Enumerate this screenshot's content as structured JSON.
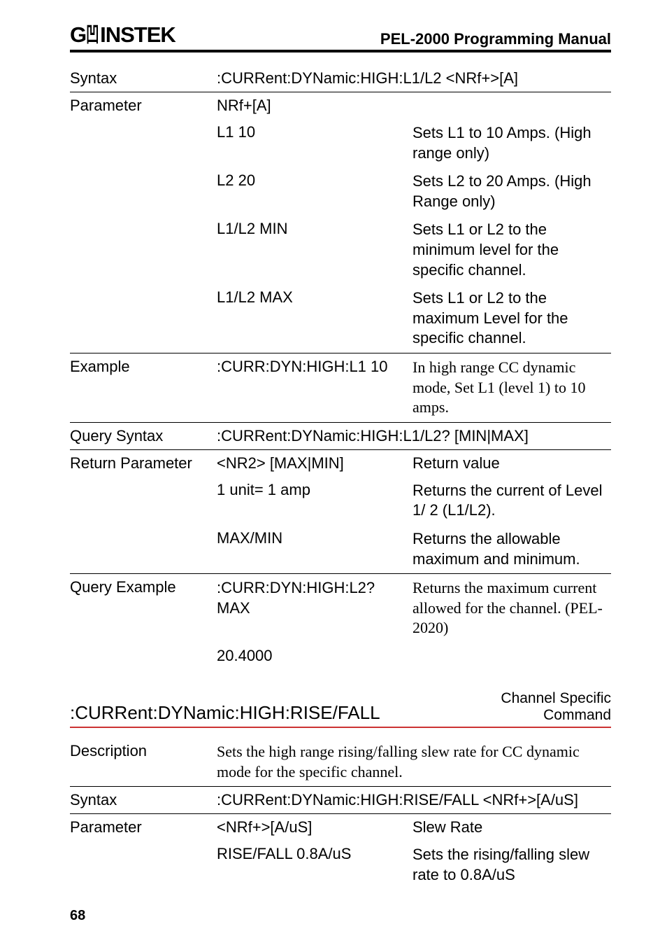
{
  "header": {
    "logo_pre": "G",
    "logo_post": "INSTEK",
    "manual": "PEL-2000 Programming Manual"
  },
  "tbl1": {
    "rows": [
      {
        "cls": "",
        "c1": "Syntax",
        "c2": ":CURRent:DYNamic:HIGH:L1/L2 <NRf+>[A]",
        "c3": "",
        "span": true,
        "c2cls": "sans"
      },
      {
        "cls": "sep",
        "c1": "Parameter",
        "c2": "NRf+[A]",
        "c3": "",
        "c2cls": "sans"
      },
      {
        "cls": "",
        "c1": "",
        "c2": "L1 10",
        "c3": "Sets L1 to 10 Amps. (High range only)",
        "c2cls": "sans",
        "c3cls": "sans lh"
      },
      {
        "cls": "",
        "c1": "",
        "c2": "L2 20",
        "c3": "Sets L2 to 20 Amps. (High Range only)",
        "c2cls": "sans",
        "c3cls": "sans lh"
      },
      {
        "cls": "",
        "c1": "",
        "c2": "L1/L2 MIN",
        "c3": "Sets L1 or L2 to the minimum level for the specific channel.",
        "c2cls": "sans",
        "c3cls": "sans lh"
      },
      {
        "cls": "",
        "c1": "",
        "c2": "L1/L2 MAX",
        "c3": "Sets L1 or L2 to the maximum Level for the specific channel.",
        "c2cls": "sans",
        "c3cls": "sans lh"
      },
      {
        "cls": "sep",
        "c1": "Example",
        "c2": ":CURR:DYN:HIGH:L1 10",
        "c3": "In high range CC dynamic mode, Set L1 (level 1) to 10 amps.",
        "c2cls": "sans",
        "c3cls": "serif lh"
      },
      {
        "cls": "sep",
        "c1": "Query Syntax",
        "c2": ":CURRent:DYNamic:HIGH:L1/L2? [MIN|MAX]",
        "c3": "",
        "span": true,
        "c2cls": "sans"
      },
      {
        "cls": "sep",
        "c1": "Return Parameter",
        "c2": "<NR2> [MAX|MIN]",
        "c3": "Return value",
        "c2cls": "sans",
        "c3cls": "sans"
      },
      {
        "cls": "",
        "c1": "",
        "c2": "1 unit= 1 amp",
        "c3": "Returns the current of Level 1/ 2 (L1/L2).",
        "c2cls": "sans",
        "c3cls": "sans lh"
      },
      {
        "cls": "",
        "c1": "",
        "c2": "MAX/MIN",
        "c3": "Returns the allowable maximum and minimum.",
        "c2cls": "sans",
        "c3cls": "sans lh"
      },
      {
        "cls": "sep",
        "c1": "Query Example",
        "c2": ":CURR:DYN:HIGH:L2? MAX",
        "c3": "Returns the maximum current allowed for the channel. (PEL-2020)",
        "c2cls": "sans lh",
        "c3cls": "serif lh"
      },
      {
        "cls": "",
        "c1": "",
        "c2": "20.4000",
        "c3": "",
        "c2cls": "sans"
      }
    ]
  },
  "section": {
    "cmd": ":CURRent:DYNamic:HIGH:RISE/FALL",
    "tag_l1": "Channel Specific",
    "tag_l2": "Command"
  },
  "tbl2": {
    "rows": [
      {
        "cls": "",
        "c1": "Description",
        "c2": "Sets the high range rising/falling slew rate for CC dynamic mode for the specific channel.",
        "c3": "",
        "span": true,
        "c2cls": "serif lh"
      },
      {
        "cls": "sep",
        "c1": "Syntax",
        "c2": ":CURRent:DYNamic:HIGH:RISE/FALL <NRf+>[A/uS]",
        "c3": "",
        "span": true,
        "c2cls": "sans"
      },
      {
        "cls": "sep",
        "c1": "Parameter",
        "c2": "<NRf+>[A/uS]",
        "c3": "Slew Rate",
        "c2cls": "sans",
        "c3cls": "sans"
      },
      {
        "cls": "",
        "c1": "",
        "c2": "RISE/FALL 0.8A/uS",
        "c3": "Sets the rising/falling slew rate to 0.8A/uS",
        "c2cls": "sans",
        "c3cls": "sans lh"
      }
    ]
  },
  "page": "68"
}
